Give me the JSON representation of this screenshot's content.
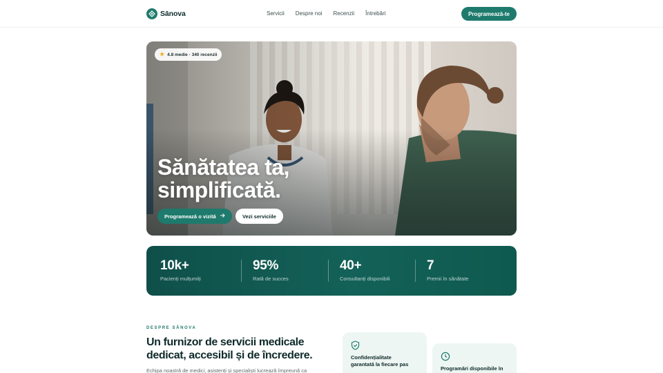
{
  "brand": {
    "name": "Sānova"
  },
  "nav": {
    "items": [
      "Servicii",
      "Despre noi",
      "Recenzii",
      "Întrebări"
    ]
  },
  "header": {
    "cta": "Programează-te"
  },
  "hero": {
    "rating": "4.8 medie · 340 recenzii",
    "title_line1": "Sănătatea ta,",
    "title_line2": "simplificată.",
    "primary_button": "Programează o vizită",
    "secondary_button": "Vezi serviciile"
  },
  "stats": [
    {
      "value": "10k+",
      "label": "Pacienți mulțumiți"
    },
    {
      "value": "95%",
      "label": "Rată de succes"
    },
    {
      "value": "40+",
      "label": "Consultanți disponibili"
    },
    {
      "value": "7",
      "label": "Premii în sănătate"
    }
  ],
  "about": {
    "eyebrow": "DESPRE SĀNOVA",
    "title": "Un furnizor de servicii medicale dedicat, accesibil și de încredere.",
    "body": "Echipa noastră de medici, asistenți și specialiști lucrează împreună ca"
  },
  "features": [
    {
      "icon": "shield-check-icon",
      "text_line1": "Confidențialitate",
      "text_line2": "garantată la fiecare pas"
    },
    {
      "icon": "clock-icon",
      "text_line1": "Programări disponibile în",
      "text_line2": ""
    }
  ],
  "colors": {
    "accent": "#1e7a6c",
    "stats_bg": "#0f4f4a",
    "feature_bg": "#edf6f3",
    "star": "#f2b01e"
  }
}
